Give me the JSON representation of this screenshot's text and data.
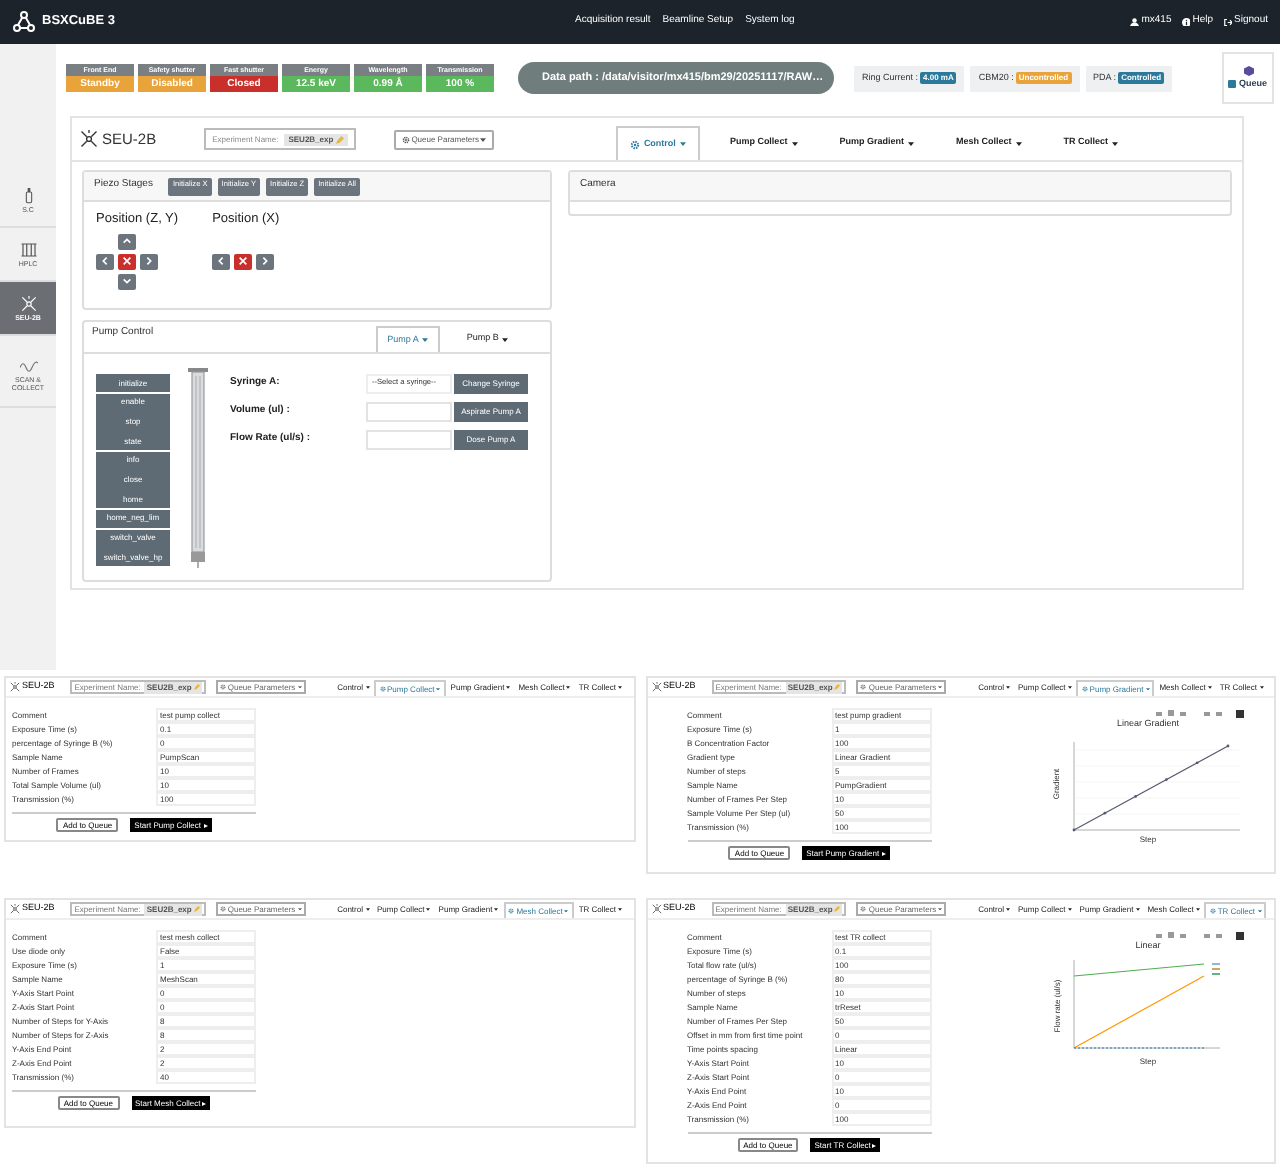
{
  "navbar": {
    "title": "BSXCuBE 3",
    "links": [
      "Acquisition result",
      "Beamline Setup",
      "System log"
    ],
    "user": "mx415",
    "help": "Help",
    "signout": "Signout"
  },
  "status": [
    {
      "label": "Front End",
      "value": "Standby",
      "color": "#e8a33a"
    },
    {
      "label": "Safety shutter",
      "value": "Disabled",
      "color": "#e8a33a"
    },
    {
      "label": "Fast shutter",
      "value": "Closed",
      "color": "#c9302c"
    },
    {
      "label": "Energy",
      "value": "12.5 keV",
      "color": "#5cb85c"
    },
    {
      "label": "Wavelength",
      "value": "0.99 Å",
      "color": "#5cb85c"
    },
    {
      "label": "Transmission",
      "value": "100 %",
      "color": "#5cb85c"
    }
  ],
  "data_path": "Data path : /data/visitor/mx415/bm29/20251117/RAW…",
  "indicators": [
    {
      "label": "Ring Current :",
      "value": "4.00 mA",
      "color": "#2b7a9b"
    },
    {
      "label": "CBM20 :",
      "value": "Uncontrolled",
      "color": "#e8a33a"
    },
    {
      "label": "PDA :",
      "value": "Controlled",
      "color": "#2b7a9b"
    }
  ],
  "queue_button": "Queue",
  "sidebar": [
    {
      "label": "S.C",
      "selected": false
    },
    {
      "label": "HPLC",
      "selected": false
    },
    {
      "label": "SEU-2B",
      "selected": true
    },
    {
      "label": "SCAN & COLLECT",
      "selected": false
    }
  ],
  "header": {
    "title": "SEU-2B",
    "name_label": "Experiment Name:",
    "name_value": "SEU2B_exp",
    "queue_parameters": "Queue Parameters"
  },
  "tabs": [
    {
      "label": "Control",
      "selected": true
    },
    {
      "label": "Pump Collect",
      "selected": false
    },
    {
      "label": "Pump Gradient",
      "selected": false
    },
    {
      "label": "Mesh Collect",
      "selected": false
    },
    {
      "label": "TR Collect",
      "selected": false
    }
  ],
  "piezo": {
    "title": "Piezo Stages",
    "buttons": [
      "Initialize X",
      "Initialize Y",
      "Initialize Z",
      "Initialize All"
    ],
    "position_zy": "Position (Z, Y)",
    "position_x": "Position (X)"
  },
  "camera": {
    "title": "Camera"
  },
  "pump": {
    "title": "Pump Control",
    "tabs": [
      {
        "label": "Pump A",
        "selected": true
      },
      {
        "label": "Pump B",
        "selected": false
      }
    ],
    "commands": [
      "initialize",
      "enable",
      "stop",
      "state",
      "info",
      "close",
      "home",
      "home_neg_lim",
      "switch_valve",
      "switch_valve_hp"
    ],
    "fields": [
      {
        "label": "Syringe A:",
        "kind": "select",
        "value": "--Select a syringe--",
        "button": "Change Syringe"
      },
      {
        "label": "Volume (ul) :",
        "kind": "input",
        "button": "Aspirate Pump A"
      },
      {
        "label": "Flow Rate (ul/s) :",
        "kind": "input",
        "button": "Dose Pump A"
      }
    ]
  },
  "examples": [
    {
      "header": {
        "title": "SEU-2B",
        "name_label": "Experiment Name:",
        "name_value": "SEU2B_exp",
        "queue_parameters": "Queue Parameters"
      },
      "tabs": [
        {
          "label": "Control",
          "selected": false
        },
        {
          "label": "Pump Collect",
          "selected": true
        },
        {
          "label": "Pump Gradient",
          "selected": false
        },
        {
          "label": "Mesh Collect",
          "selected": false
        },
        {
          "label": "TR Collect",
          "selected": false
        }
      ],
      "rows": [
        {
          "label": "Comment",
          "value": "test pump collect"
        },
        {
          "label": "Exposure Time (s)",
          "value": "0.1"
        },
        {
          "label": "percentage of Syringe B (%)",
          "value": "0"
        },
        {
          "label": "Sample Name",
          "value": "PumpScan"
        },
        {
          "label": "Number of Frames",
          "value": "10"
        },
        {
          "label": "Total Sample Volume (ul)",
          "value": "10"
        },
        {
          "label": "Transmission (%)",
          "value": "100"
        }
      ],
      "add_button": "Add to Queue",
      "start_button": "Start Pump Collect"
    },
    {
      "header": {
        "title": "SEU-2B",
        "name_label": "Experiment Name:",
        "name_value": "SEU2B_exp",
        "queue_parameters": "Queue Parameters"
      },
      "tabs": [
        {
          "label": "Control",
          "selected": false
        },
        {
          "label": "Pump Collect",
          "selected": false
        },
        {
          "label": "Pump Gradient",
          "selected": true
        },
        {
          "label": "Mesh Collect",
          "selected": false
        },
        {
          "label": "TR Collect",
          "selected": false
        }
      ],
      "rows": [
        {
          "label": "Comment",
          "value": "test pump gradient"
        },
        {
          "label": "Exposure Time (s)",
          "value": "1"
        },
        {
          "label": "B Concentration Factor",
          "value": "100"
        },
        {
          "label": "Gradient type",
          "value": "Linear Gradient"
        },
        {
          "label": "Number of steps",
          "value": "5"
        },
        {
          "label": "Sample Name",
          "value": "PumpGradient"
        },
        {
          "label": "Number of Frames Per Step",
          "value": "10"
        },
        {
          "label": "Sample Volume Per Step (ul)",
          "value": "50"
        },
        {
          "label": "Transmission (%)",
          "value": "100"
        }
      ],
      "add_button": "Add to Queue",
      "start_button": "Start Pump Gradient",
      "chart": {
        "kind": "gradient",
        "title": "Linear Gradient",
        "xlabel": "Step",
        "ylabel": "Gradient"
      }
    },
    {
      "header": {
        "title": "SEU-2B",
        "name_label": "Experiment Name:",
        "name_value": "SEU2B_exp",
        "queue_parameters": "Queue Parameters"
      },
      "tabs": [
        {
          "label": "Control",
          "selected": false
        },
        {
          "label": "Pump Collect",
          "selected": false
        },
        {
          "label": "Pump Gradient",
          "selected": false
        },
        {
          "label": "Mesh Collect",
          "selected": true
        },
        {
          "label": "TR Collect",
          "selected": false
        }
      ],
      "rows": [
        {
          "label": "Comment",
          "value": "test mesh collect"
        },
        {
          "label": "Use diode only",
          "value": "False"
        },
        {
          "label": "Exposure Time (s)",
          "value": "1"
        },
        {
          "label": "Sample Name",
          "value": "MeshScan"
        },
        {
          "label": "Y-Axis Start Point",
          "value": "0"
        },
        {
          "label": "Z-Axis Start Point",
          "value": "0"
        },
        {
          "label": "Number of Steps for Y-Axis",
          "value": "8"
        },
        {
          "label": "Number of Steps for Z-Axis",
          "value": "8"
        },
        {
          "label": "Y-Axis End Point",
          "value": "2"
        },
        {
          "label": "Z-Axis End Point",
          "value": "2"
        },
        {
          "label": "Transmission (%)",
          "value": "40"
        }
      ],
      "add_button": "Add to Queue",
      "start_button": "Start Mesh Collect"
    },
    {
      "header": {
        "title": "SEU-2B",
        "name_label": "Experiment Name:",
        "name_value": "SEU2B_exp",
        "queue_parameters": "Queue Parameters"
      },
      "tabs": [
        {
          "label": "Control",
          "selected": false
        },
        {
          "label": "Pump Collect",
          "selected": false
        },
        {
          "label": "Pump Gradient",
          "selected": false
        },
        {
          "label": "Mesh Collect",
          "selected": false
        },
        {
          "label": "TR Collect",
          "selected": true
        }
      ],
      "rows": [
        {
          "label": "Comment",
          "value": "test TR collect"
        },
        {
          "label": "Exposure Time (s)",
          "value": "0.1"
        },
        {
          "label": "Total flow rate (ul/s)",
          "value": "100"
        },
        {
          "label": "percentage of Syringe B (%)",
          "value": "80"
        },
        {
          "label": "Number of steps",
          "value": "10"
        },
        {
          "label": "Sample Name",
          "value": "trReset"
        },
        {
          "label": "Number of Frames Per Step",
          "value": "50"
        },
        {
          "label": "Offset in mm from first time point",
          "value": "0"
        },
        {
          "label": "Time points spacing",
          "value": "Linear"
        },
        {
          "label": "Y-Axis Start Point",
          "value": "10"
        },
        {
          "label": "Z-Axis Start Point",
          "value": "0"
        },
        {
          "label": "Y-Axis End Point",
          "value": "10"
        },
        {
          "label": "Z-Axis End Point",
          "value": "0"
        },
        {
          "label": "Transmission (%)",
          "value": "100"
        }
      ],
      "add_button": "Add to Queue",
      "start_button": "Start TR Collect",
      "chart": {
        "kind": "tr",
        "title": "Linear",
        "xlabel": "Step",
        "ylabel": "Flow rate (ul/s)"
      }
    }
  ]
}
